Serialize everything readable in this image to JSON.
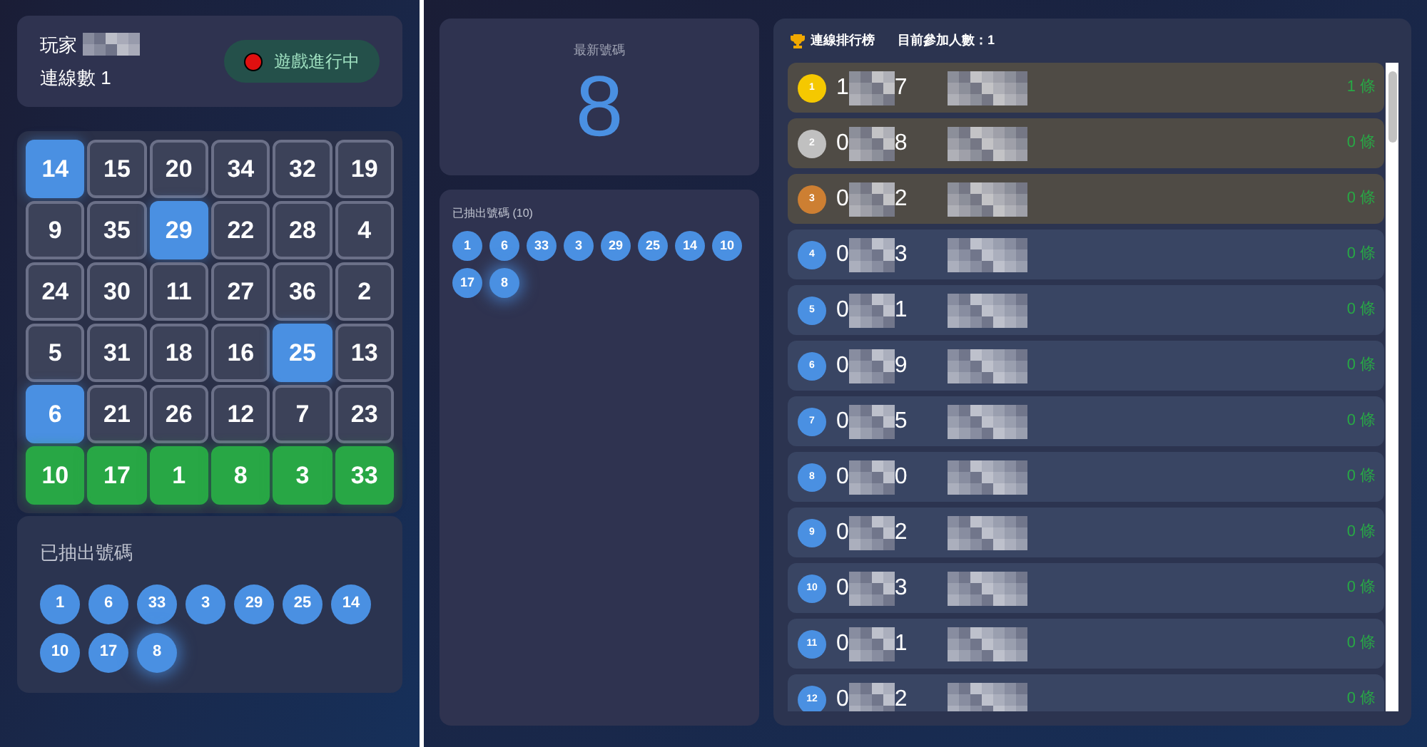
{
  "player": {
    "label": "玩家",
    "streak": "連線數 1"
  },
  "status": {
    "label": "遊戲進行中",
    "on": true
  },
  "grid": [
    [
      {
        "n": "14",
        "marked": true,
        "in_line": false
      },
      {
        "n": "15",
        "marked": false,
        "in_line": false
      },
      {
        "n": "20",
        "marked": false,
        "in_line": false
      },
      {
        "n": "34",
        "marked": false,
        "in_line": false
      },
      {
        "n": "32",
        "marked": false,
        "in_line": false
      },
      {
        "n": "19",
        "marked": false,
        "in_line": false
      }
    ],
    [
      {
        "n": "9",
        "marked": false,
        "in_line": false
      },
      {
        "n": "35",
        "marked": false,
        "in_line": false
      },
      {
        "n": "29",
        "marked": true,
        "in_line": false
      },
      {
        "n": "22",
        "marked": false,
        "in_line": false
      },
      {
        "n": "28",
        "marked": false,
        "in_line": false
      },
      {
        "n": "4",
        "marked": false,
        "in_line": false
      }
    ],
    [
      {
        "n": "24",
        "marked": false,
        "in_line": false
      },
      {
        "n": "30",
        "marked": false,
        "in_line": false
      },
      {
        "n": "11",
        "marked": false,
        "in_line": false
      },
      {
        "n": "27",
        "marked": false,
        "in_line": false
      },
      {
        "n": "36",
        "marked": false,
        "in_line": false
      },
      {
        "n": "2",
        "marked": false,
        "in_line": false
      }
    ],
    [
      {
        "n": "5",
        "marked": false,
        "in_line": false
      },
      {
        "n": "31",
        "marked": false,
        "in_line": false
      },
      {
        "n": "18",
        "marked": false,
        "in_line": false
      },
      {
        "n": "16",
        "marked": false,
        "in_line": false
      },
      {
        "n": "25",
        "marked": true,
        "in_line": false
      },
      {
        "n": "13",
        "marked": false,
        "in_line": false
      }
    ],
    [
      {
        "n": "6",
        "marked": true,
        "in_line": false
      },
      {
        "n": "21",
        "marked": false,
        "in_line": false
      },
      {
        "n": "26",
        "marked": false,
        "in_line": false
      },
      {
        "n": "12",
        "marked": false,
        "in_line": false
      },
      {
        "n": "7",
        "marked": false,
        "in_line": false
      },
      {
        "n": "23",
        "marked": false,
        "in_line": false
      }
    ],
    [
      {
        "n": "10",
        "marked": true,
        "in_line": true
      },
      {
        "n": "17",
        "marked": true,
        "in_line": true
      },
      {
        "n": "1",
        "marked": true,
        "in_line": true
      },
      {
        "n": "8",
        "marked": true,
        "in_line": true
      },
      {
        "n": "3",
        "marked": true,
        "in_line": true
      },
      {
        "n": "33",
        "marked": true,
        "in_line": true
      }
    ]
  ],
  "drawn_left": {
    "title": "已抽出號碼",
    "balls": [
      {
        "n": "1",
        "latest": false
      },
      {
        "n": "6",
        "latest": false
      },
      {
        "n": "33",
        "latest": false
      },
      {
        "n": "3",
        "latest": false
      },
      {
        "n": "29",
        "latest": false
      },
      {
        "n": "25",
        "latest": false
      },
      {
        "n": "14",
        "latest": false
      },
      {
        "n": "10",
        "latest": false
      },
      {
        "n": "17",
        "latest": false
      },
      {
        "n": "8",
        "latest": true
      }
    ]
  },
  "latest": {
    "label": "最新號碼",
    "number": "8"
  },
  "drawn_right": {
    "title": "已抽出號碼 (10)",
    "balls": [
      {
        "n": "1",
        "latest": false
      },
      {
        "n": "6",
        "latest": false
      },
      {
        "n": "33",
        "latest": false
      },
      {
        "n": "3",
        "latest": false
      },
      {
        "n": "29",
        "latest": false
      },
      {
        "n": "25",
        "latest": false
      },
      {
        "n": "14",
        "latest": false
      },
      {
        "n": "10",
        "latest": false
      },
      {
        "n": "17",
        "latest": false
      },
      {
        "n": "8",
        "latest": true
      }
    ]
  },
  "leaderboard": {
    "title": "連線排行榜",
    "count": "目前參加人數：1",
    "rows": [
      {
        "rank": "1",
        "color": "#f5c800",
        "highlighted": true,
        "id_start": "1",
        "id_end": "7",
        "lines": "1 條"
      },
      {
        "rank": "2",
        "color": "#c0c0c0",
        "highlighted": true,
        "id_start": "0",
        "id_end": "8",
        "lines": "0 條"
      },
      {
        "rank": "3",
        "color": "#cd7f32",
        "highlighted": true,
        "id_start": "0",
        "id_end": "2",
        "lines": "0 條"
      },
      {
        "rank": "4",
        "color": "#4a90e2",
        "highlighted": false,
        "id_start": "0",
        "id_end": "3",
        "lines": "0 條"
      },
      {
        "rank": "5",
        "color": "#4a90e2",
        "highlighted": false,
        "id_start": "0",
        "id_end": "1",
        "lines": "0 條"
      },
      {
        "rank": "6",
        "color": "#4a90e2",
        "highlighted": false,
        "id_start": "0",
        "id_end": "9",
        "lines": "0 條"
      },
      {
        "rank": "7",
        "color": "#4a90e2",
        "highlighted": false,
        "id_start": "0",
        "id_end": "5",
        "lines": "0 條"
      },
      {
        "rank": "8",
        "color": "#4a90e2",
        "highlighted": false,
        "id_start": "0",
        "id_end": "0",
        "lines": "0 條"
      },
      {
        "rank": "9",
        "color": "#4a90e2",
        "highlighted": false,
        "id_start": "0",
        "id_end": "2",
        "lines": "0 條"
      },
      {
        "rank": "10",
        "color": "#4a90e2",
        "highlighted": false,
        "id_start": "0",
        "id_end": "3",
        "lines": "0 條"
      },
      {
        "rank": "11",
        "color": "#4a90e2",
        "highlighted": false,
        "id_start": "0",
        "id_end": "1",
        "lines": "0 條"
      },
      {
        "rank": "12",
        "color": "#4a90e2",
        "highlighted": false,
        "id_start": "0",
        "id_end": "2",
        "lines": "0 條"
      }
    ]
  }
}
